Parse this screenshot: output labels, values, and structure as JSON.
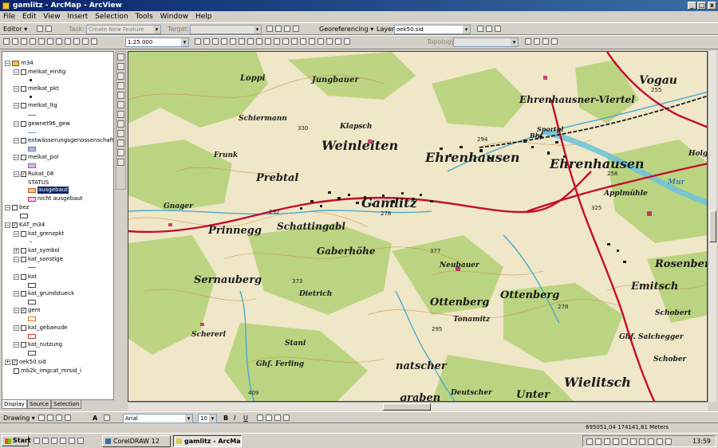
{
  "window": {
    "title": "gamlitz - ArcMap - ArcView",
    "min": "_",
    "max": "□",
    "close": "x"
  },
  "menu": [
    "File",
    "Edit",
    "View",
    "Insert",
    "Selection",
    "Tools",
    "Window",
    "Help"
  ],
  "editor": {
    "label": "Editor ▾",
    "task_label": "Task:",
    "task_value": "Create New Feature",
    "target_label": "Target:",
    "target_value": ""
  },
  "georef": {
    "label": "Georeferencing ▾",
    "layer_label": "Layer:",
    "layer_value": "oek50.sid"
  },
  "standard": {
    "scale": "1:25.000",
    "topology_label": "Topology:"
  },
  "toc": {
    "root": "m34",
    "layers": [
      {
        "name": "melkat_einltg"
      },
      {
        "name": "melkat_pkt"
      },
      {
        "name": "melkat_ltg"
      },
      {
        "name": "gewnet96_gew"
      },
      {
        "name": "entwässerungsgenossenschaften"
      },
      {
        "name": "melkat_pol"
      },
      {
        "name": "Rukat_08"
      },
      {
        "name": "STATUS"
      },
      {
        "name": "ausgebaut"
      },
      {
        "name": "nicht ausgebaut"
      },
      {
        "name": "bez"
      },
      {
        "name": "KAT_m34"
      },
      {
        "name": "kat_grenzpkt"
      },
      {
        "name": "kat_symbol"
      },
      {
        "name": "kat_sonstige"
      },
      {
        "name": "kat"
      },
      {
        "name": "kat_grundstueck"
      },
      {
        "name": "gem"
      },
      {
        "name": "kat_gebaeude"
      },
      {
        "name": "kat_nutzung"
      },
      {
        "name": "oek50.sid"
      },
      {
        "name": "mb2k_imgcat_mrsid_i"
      }
    ],
    "tabs": [
      "Display",
      "Source",
      "Selection"
    ]
  },
  "map": {
    "place_labels": [
      "Jungbauer",
      "Loppi",
      "Schiermann",
      "Klapsch",
      "Weinleiten",
      "Ehrenhausen",
      "Ehrenhausen",
      "Vogau",
      "Ehrenhausner-Viertel",
      "Frunk",
      "Prebtal",
      "Gamlitz",
      "Gnager",
      "Prinnegg",
      "Schattingabl",
      "Gaberhöhe",
      "Neubauer",
      "Rosenberg",
      "Emitsch",
      "Sernauberg",
      "Dietrich",
      "Ottenberg",
      "Ottenberg",
      "Tonamitz",
      "Schobert",
      "Schererl",
      "Ghf. Salchegger",
      "Schober",
      "Ghf. Ferling",
      "Stani",
      "natscher",
      "graben",
      "Deutscher",
      "Unter",
      "Wielitsch",
      "Applmühle",
      "Holg",
      "Sportpl",
      "Bhf.",
      "Mur"
    ],
    "spot_heights": [
      "330",
      "255",
      "294",
      "258",
      "292",
      "278",
      "325",
      "377",
      "373",
      "278",
      "295",
      "409"
    ],
    "colors": {
      "forest": "#b9d47e",
      "water": "#6fc3d9",
      "road": "#c40e2c",
      "rail": "#202020",
      "text": "#1a1a1a",
      "contour": "#c8863c"
    }
  },
  "drawing": {
    "label": "Drawing ▾",
    "font": "Arial",
    "size": "10",
    "bold": "B",
    "italic": "I",
    "underline": "U",
    "text_tool": "A"
  },
  "status": {
    "coords": "695051,04  174141,81 Meters"
  },
  "taskbar": {
    "start": "Start",
    "tasks": [
      "CorelDRAW 12",
      "gamlitz - ArcMap ..."
    ],
    "clock": "13:59"
  }
}
